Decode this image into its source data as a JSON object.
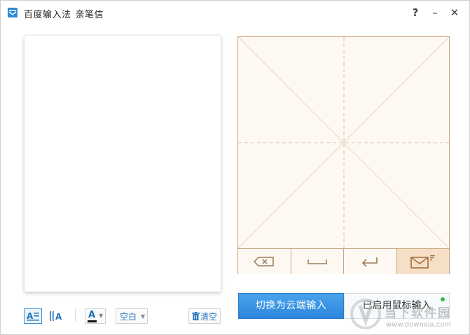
{
  "window": {
    "title": "百度输入法",
    "subtitle": "亲笔信"
  },
  "titlebar": {
    "help_label": "?",
    "minimize_label": "–",
    "close_label": "✕"
  },
  "toolbar": {
    "text_color_label": "A",
    "background_label": "空白",
    "clear_label": "清空"
  },
  "pad": {
    "buttons": [
      "backspace",
      "space",
      "enter",
      "send-letter"
    ],
    "active_button": "send-letter"
  },
  "actions": {
    "cloud_label": "切换为云端输入",
    "mouse_label": "已启用鼠标输入"
  },
  "watermark": {
    "site_name": "当下软件园",
    "url": "www.downxia.com"
  },
  "colors": {
    "accent": "#2c86dc",
    "pad_bg": "#fdf8f2",
    "pad_border": "#c9a67d",
    "status_on": "#2ec04c"
  }
}
